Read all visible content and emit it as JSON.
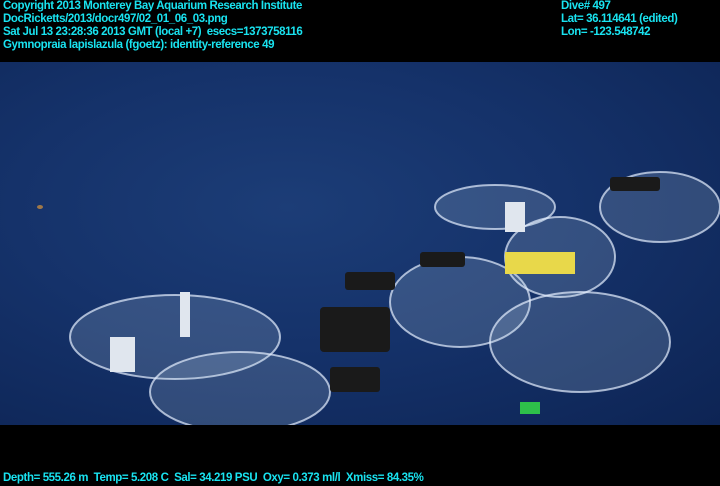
{
  "header": {
    "copyright": "Copyright 2013 Monterey Bay Aquarium Research Institute",
    "file": "DocRicketts/2013/docr497/02_01_06_03.png",
    "datetime": "Sat Jul 13 23:28:36 2013 GMT (local +7)  esecs=1373758116",
    "annotation": "Gymnopraia lapislazula (fgoetz): identity-reference 49"
  },
  "nav": {
    "dive": "Dive# 497",
    "lat": "Lat= 36.114641 (edited)",
    "lon": "Lon= -123.548742"
  },
  "footer": {
    "sensors": "Depth= 555.26 m  Temp= 5.208 C  Sal= 34.219 PSU  Oxy= 0.373 ml/l  Xmiss= 84.35%"
  }
}
